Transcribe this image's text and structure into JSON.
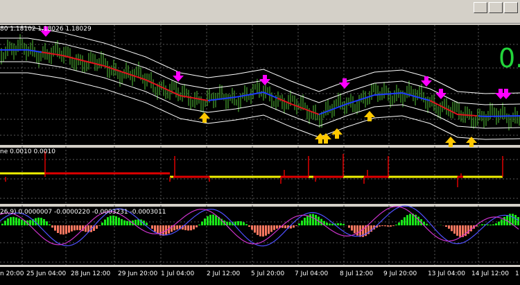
{
  "main_chart": {
    "header_text": "80 1.18102 1.18026 1.18029",
    "big_price_fragment": "0."
  },
  "indicator1": {
    "header_text": "ne 0.0010 0.0010"
  },
  "indicator2": {
    "header_text": "26,9) 0.0000007 -0.0000220 -0.0003231 -0.0003011"
  },
  "time_axis": [
    "n 20:00",
    "25 Jun 04:00",
    "28 Jun 12:00",
    "29 Jun 20:00",
    "1 Jul 04:00",
    "2 Jul 12:00",
    "5 Jul 20:00",
    "7 Jul 04:00",
    "8 Jul 12:00",
    "9 Jul 20:00",
    "13 Jul 04:00",
    "14 Jul 12:00",
    "1"
  ],
  "colors": {
    "background": "#000000",
    "grid": "#5a5a5a",
    "candles": "#3c8c28",
    "ma_red": "#e0141e",
    "ma_blue": "#1e3cff",
    "band": "#ffffff",
    "sell_arrow": "#ff00ff",
    "buy_arrow": "#ffc800",
    "step_yellow": "#f0f000",
    "step_red": "#e00000",
    "hist_green": "#19e819",
    "hist_red": "#ff7860",
    "macd_blue": "#5050ff",
    "signal_purple": "#cc33cc",
    "price_text": "#22d43a"
  }
}
